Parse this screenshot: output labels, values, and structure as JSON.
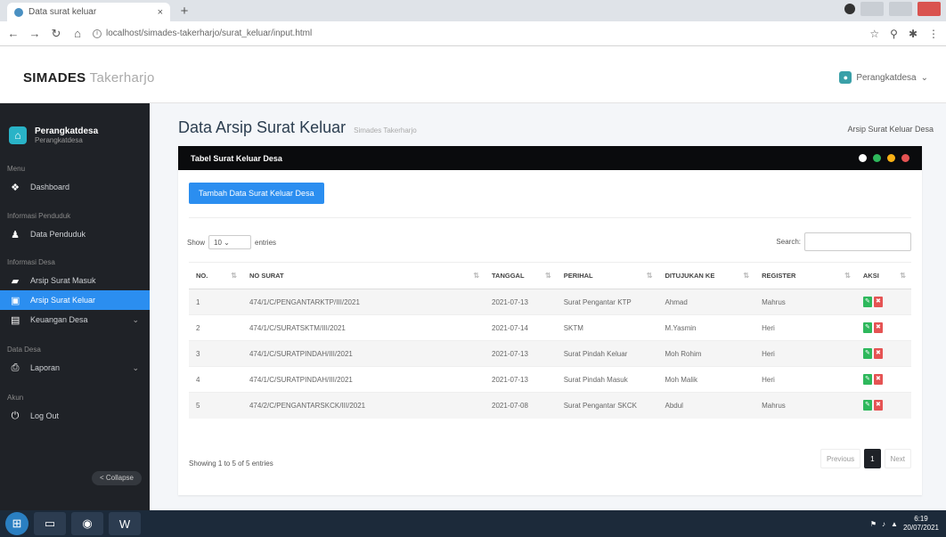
{
  "browser": {
    "tab_title": "Data surat keluar",
    "tab_close": "×",
    "new_tab": "+",
    "url": "localhost/simades-takerharjo/surat_keluar/input.html"
  },
  "header": {
    "brand_bold": "SIMADES",
    "brand_light": "Takerharjo",
    "user_label": "Perangkatdesa"
  },
  "sidebar": {
    "user_name": "Perangkatdesa",
    "user_role": "Perangkatdesa",
    "sections": [
      "Menu",
      "Informasi Penduduk",
      "Informasi Desa",
      "Data Desa",
      "Akun"
    ],
    "items": [
      {
        "label": "Dashboard",
        "icon": "dashboard-icon"
      },
      {
        "label": "Data Penduduk",
        "icon": "person-icon"
      },
      {
        "label": "Arsip Surat Masuk",
        "icon": "inbox-icon"
      },
      {
        "label": "Arsip Surat Keluar",
        "icon": "outbox-icon"
      },
      {
        "label": "Keuangan Desa",
        "icon": "money-icon"
      },
      {
        "label": "Laporan",
        "icon": "printer-icon"
      },
      {
        "label": "Log Out",
        "icon": "logout-icon"
      }
    ],
    "collapse_label": "< Collapse"
  },
  "main": {
    "title": "Data Arsip Surat Keluar",
    "title_sub": "Simades Takerharjo",
    "breadcrumb": "Arsip Surat Keluar Desa",
    "card_title": "Tabel Surat Keluar Desa",
    "dot_colors": [
      "#ffffff",
      "#2eb85c",
      "#f9b115",
      "#e55353"
    ],
    "add_button": "Tambah Data Surat Keluar Desa",
    "show_label": "Show",
    "show_value": "10",
    "entries_label": "entries",
    "search_label": "Search:",
    "columns": [
      "NO.",
      "NO SURAT",
      "TANGGAL",
      "PERIHAL",
      "DITUJUKAN KE",
      "REGISTER",
      "AKSI"
    ],
    "rows": [
      [
        "1",
        "474/1/C/PENGANTARKTP/III/2021",
        "2021-07-13",
        "Surat Pengantar KTP",
        "Ahmad",
        "Mahrus"
      ],
      [
        "2",
        "474/1/C/SURATSKTM/III/2021",
        "2021-07-14",
        "SKTM",
        "M.Yasmin",
        "Heri"
      ],
      [
        "3",
        "474/1/C/SURATPINDAH/III/2021",
        "2021-07-13",
        "Surat Pindah Keluar",
        "Moh Rohim",
        "Heri"
      ],
      [
        "4",
        "474/1/C/SURATPINDAH/III/2021",
        "2021-07-13",
        "Surat Pindah Masuk",
        "Moh Malik",
        "Heri"
      ],
      [
        "5",
        "474/2/C/PENGANTARSKCK/III/2021",
        "2021-07-08",
        "Surat Pengantar SKCK",
        "Abdul",
        "Mahrus"
      ]
    ],
    "info": "Showing 1 to 5 of 5 entries",
    "prev": "Previous",
    "page": "1",
    "next": "Next"
  },
  "taskbar": {
    "time": "6:19",
    "date": "20/07/2021"
  }
}
